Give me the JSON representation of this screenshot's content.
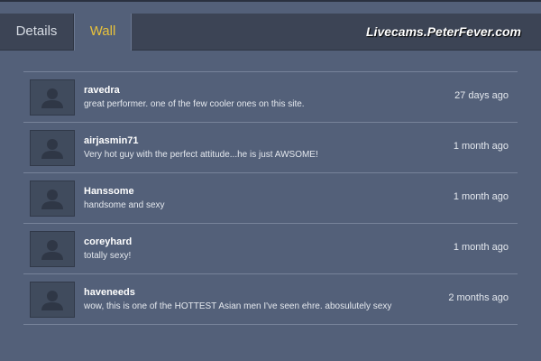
{
  "tabs": [
    {
      "label": "Details",
      "active": false
    },
    {
      "label": "Wall",
      "active": true
    }
  ],
  "brand": "Livecams.PeterFever.com",
  "colors": {
    "active_tab": "#e7c13b",
    "panel_bg": "#536079",
    "topbar_bg": "#3c4455"
  },
  "posts": [
    {
      "user": "ravedra",
      "text": "great performer. one of the few cooler ones on this site.",
      "time": "27 days ago",
      "avatar_icon": "default-user-avatar-icon"
    },
    {
      "user": "airjasmin71",
      "text": "Very hot guy with the perfect attitude...he is just AWSOME!",
      "time": "1 month ago",
      "avatar_icon": "default-user-avatar-icon"
    },
    {
      "user": "Hanssome",
      "text": "handsome and sexy",
      "time": "1 month ago",
      "avatar_icon": "default-user-avatar-icon"
    },
    {
      "user": "coreyhard",
      "text": "totally sexy!",
      "time": "1 month ago",
      "avatar_icon": "default-user-avatar-icon"
    },
    {
      "user": "haveneeds",
      "text": "wow, this is one of the HOTTEST Asian men I've seen ehre. abosulutely sexy",
      "time": "2 months ago",
      "avatar_icon": "default-user-avatar-icon"
    }
  ]
}
